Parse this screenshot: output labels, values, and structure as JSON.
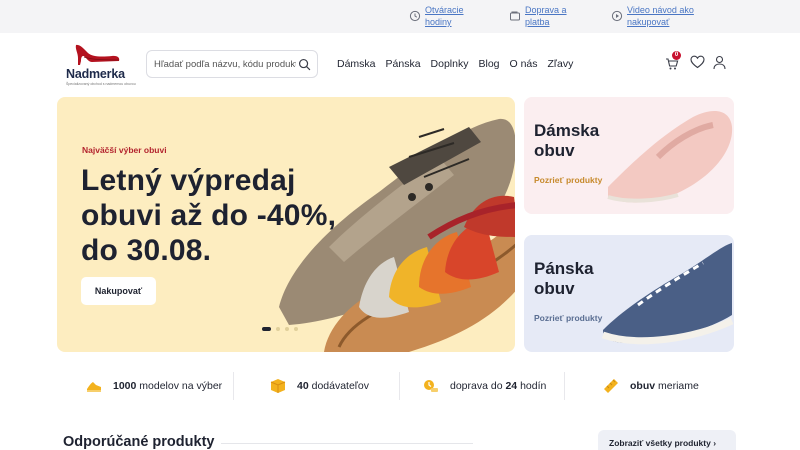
{
  "topbar": {
    "hours_link": [
      "Otváracie",
      "hodiny"
    ],
    "delivery_link": [
      "Doprava a",
      "platba"
    ],
    "video_link": [
      "Video návod ako",
      "nakupovať"
    ]
  },
  "header": {
    "logo_name": "Nadmerka",
    "logo_tagline": "Špecializovaný obchod s nadmernou obuvou",
    "search_placeholder": "Hľadať podľa názvu, kódu produktu",
    "nav": [
      "Dámska",
      "Pánska",
      "Doplnky",
      "Blog",
      "O nás",
      "Zľavy"
    ],
    "cart_count": "0"
  },
  "hero": {
    "eyebrow": "Najväčší výber obuvi",
    "headline": "Letný výpredaj obuvi až do -40%, do 30.08.",
    "button": "Nakupovať",
    "slides": 4,
    "active_slide": 1
  },
  "cards": {
    "women": {
      "title": "Dámska obuv",
      "link": "Pozrieť produkty"
    },
    "men": {
      "title": "Pánska obuv",
      "link": "Pozrieť produkty"
    }
  },
  "features": [
    {
      "bold": "1000",
      "text": " modelov na výber",
      "icon": "shoe-box-icon"
    },
    {
      "bold": "40",
      "text": " dodávateľov",
      "icon": "package-icon"
    },
    {
      "pre": "doprava do ",
      "bold": "24",
      "text": " hodín",
      "icon": "delivery-icon"
    },
    {
      "bold": "obuv",
      "text": " meriame",
      "icon": "ruler-icon"
    }
  ],
  "recommended": {
    "title": "Odporúčané produkty",
    "button": "Zobraziť všetky produkty ›"
  },
  "colors": {
    "hero_bg": "#fdedc0",
    "accent_red": "#c8102e",
    "link_blue": "#4a76c4",
    "women_card_bg": "#fbeef0",
    "men_card_bg": "#e6eaf6"
  }
}
